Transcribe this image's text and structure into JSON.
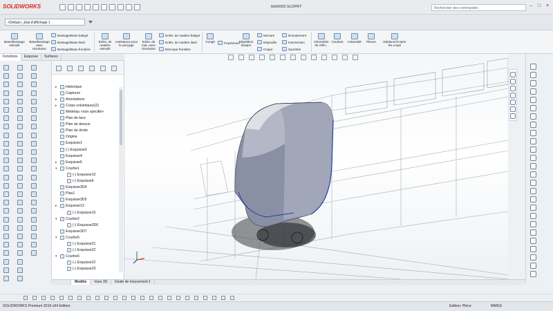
{
  "app": {
    "logo": "SOLIDWORKS",
    "doc_title": "bb56000.SLDPRT",
    "search_placeholder": "Rechercher des commandes"
  },
  "config": {
    "selected": "<Défaut>_Etat d'affichage 1"
  },
  "ribbon": {
    "big": [
      {
        "label": "Base/Bossage\nextrudé"
      },
      {
        "label": "Base/Bossage\navec\nrévolution"
      },
      {
        "label": "Enlèv. de\nmatière\nextrudé"
      },
      {
        "label": "Assistance pour\nle perçage"
      },
      {
        "label": "Enlèv. de\nmat. avec\nrévolution"
      },
      {
        "label": "Congé"
      },
      {
        "label": "Répétition\nlinéaire"
      },
      {
        "label": "Géométrie\nde référ..."
      },
      {
        "label": "Courbes"
      },
      {
        "label": "Instant3D"
      },
      {
        "label": "Plexon"
      },
      {
        "label": "Déplacer/Copier\nles corps"
      }
    ],
    "small_col1": [
      "Bossage/Base balayé",
      "Bossage/Base lissé",
      "Bossage/Base frontière"
    ],
    "small_col2": [
      "Enlèv. de matière balayé",
      "Enlèv. de matière lissé",
      "Découpe frontière"
    ],
    "small_col3": [
      "Fractionner"
    ],
    "small_col4": [
      "Nervure",
      "Dépouille",
      "Coque"
    ],
    "small_col5": [
      "Enroulement",
      "Intersection",
      "Symétrie"
    ]
  },
  "cm_tabs": [
    "Fonctions",
    "Esquisse",
    "Surfaces"
  ],
  "tree": [
    {
      "label": "Historique",
      "indent": 0,
      "tw": "▸"
    },
    {
      "label": "Capteurs",
      "indent": 0,
      "tw": ""
    },
    {
      "label": "Annotations",
      "indent": 0,
      "tw": "▸"
    },
    {
      "label": "Corps volumiques(2)",
      "indent": 0,
      "tw": "▸"
    },
    {
      "label": "Métériau <non spécifié>",
      "indent": 0,
      "tw": ""
    },
    {
      "label": "Plan de face",
      "indent": 0,
      "tw": ""
    },
    {
      "label": "Plan de dessus",
      "indent": 0,
      "tw": ""
    },
    {
      "label": "Plan de droite",
      "indent": 0,
      "tw": ""
    },
    {
      "label": "Origine",
      "indent": 0,
      "tw": ""
    },
    {
      "label": "Esquisse1",
      "indent": 0,
      "tw": ""
    },
    {
      "label": "(-) Esquisse3",
      "indent": 0,
      "tw": ""
    },
    {
      "label": "Esquisse4",
      "indent": 0,
      "tw": ""
    },
    {
      "label": "Esquisse5",
      "indent": 0,
      "tw": "▸"
    },
    {
      "label": "Courbe1",
      "indent": 0,
      "tw": "▾"
    },
    {
      "label": "(-) Esquisse10",
      "indent": 1,
      "tw": ""
    },
    {
      "label": "(-) Esquisse9",
      "indent": 1,
      "tw": ""
    },
    {
      "label": "Esquisse3D4",
      "indent": 0,
      "tw": ""
    },
    {
      "label": "Plan1",
      "indent": 0,
      "tw": ""
    },
    {
      "label": "Esquisse3D5",
      "indent": 0,
      "tw": ""
    },
    {
      "label": "Esquisse13",
      "indent": 0,
      "tw": "▸"
    },
    {
      "label": "(-) Esquisse15",
      "indent": 1,
      "tw": ""
    },
    {
      "label": "Courbe2",
      "indent": 0,
      "tw": "▾"
    },
    {
      "label": "(-) Esquisse3D6",
      "indent": 1,
      "tw": ""
    },
    {
      "label": "Esquisse3D7",
      "indent": 0,
      "tw": ""
    },
    {
      "label": "Courbe5",
      "indent": 0,
      "tw": "▾"
    },
    {
      "label": "(-) Esquisse21",
      "indent": 1,
      "tw": ""
    },
    {
      "label": "(-) Esquisse22",
      "indent": 1,
      "tw": ""
    },
    {
      "label": "Courbe6",
      "indent": 0,
      "tw": "▾"
    },
    {
      "label": "(-) Esquisse22",
      "indent": 1,
      "tw": ""
    },
    {
      "label": "(-) Esquisse23",
      "indent": 1,
      "tw": ""
    }
  ],
  "bottom_tabs": [
    "Modèle",
    "Vues 3D",
    "Etude de mouvement 1"
  ],
  "status": {
    "left": "SOLIDWORKS Premium 2016 x64 Edition",
    "mode": "Edition: Pièce",
    "units": "MMGS"
  },
  "colors": {
    "accent_red": "#d52b1e",
    "curve_blue": "#1f3fa8"
  }
}
